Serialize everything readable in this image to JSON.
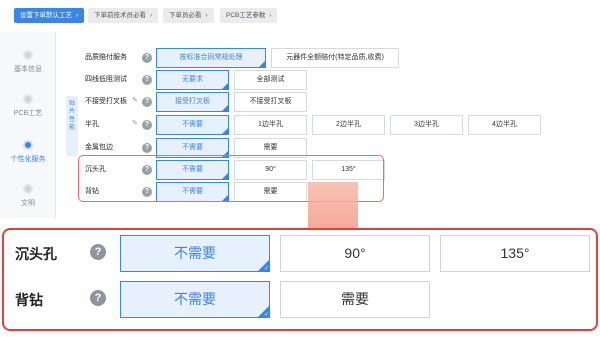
{
  "breadcrumbs": [
    {
      "label": "设置下单默认工艺",
      "active": true
    },
    {
      "label": "下单前技术员必看",
      "active": false
    },
    {
      "label": "下单员必看",
      "active": false
    },
    {
      "label": "PCB工艺参数",
      "active": false
    }
  ],
  "sidenav": {
    "items": [
      {
        "label": "基本信息",
        "active": false
      },
      {
        "label": "PCB工艺",
        "active": false
      },
      {
        "label": "个性化服务",
        "active": true
      },
      {
        "label": "文明",
        "active": false
      }
    ]
  },
  "vertical_tag": [
    "贴",
    "片",
    "性",
    "能"
  ],
  "form": {
    "rows": [
      {
        "label": "品质赔付服务",
        "has_help": true,
        "editable": false,
        "options": [
          {
            "text": "按标准合同常规处理",
            "selected": true
          },
          {
            "text": "元器件全额赔付(特定品质,收费)",
            "selected": false
          }
        ]
      },
      {
        "label": "四线低阻测试",
        "has_help": true,
        "editable": false,
        "options": [
          {
            "text": "无要求",
            "selected": true
          },
          {
            "text": "全部测试",
            "selected": false
          }
        ]
      },
      {
        "label": "不接受打叉板",
        "has_help": true,
        "editable": true,
        "options": [
          {
            "text": "接受打叉板",
            "selected": true
          },
          {
            "text": "不接受打叉板",
            "selected": false
          }
        ]
      },
      {
        "label": "半孔",
        "has_help": true,
        "editable": true,
        "options": [
          {
            "text": "不需要",
            "selected": true
          },
          {
            "text": "1边半孔",
            "selected": false
          },
          {
            "text": "2边半孔",
            "selected": false
          },
          {
            "text": "3边半孔",
            "selected": false
          },
          {
            "text": "4边半孔",
            "selected": false
          }
        ]
      },
      {
        "label": "金属包边",
        "has_help": true,
        "editable": false,
        "options": [
          {
            "text": "不需要",
            "selected": true
          },
          {
            "text": "需要",
            "selected": false
          }
        ]
      },
      {
        "label": "沉头孔",
        "has_help": true,
        "editable": false,
        "options": [
          {
            "text": "不需要",
            "selected": true
          },
          {
            "text": "90°",
            "selected": false
          },
          {
            "text": "135°",
            "selected": false
          }
        ]
      },
      {
        "label": "背钻",
        "has_help": true,
        "editable": false,
        "options": [
          {
            "text": "不需要",
            "selected": true
          },
          {
            "text": "需要",
            "selected": false
          }
        ]
      }
    ]
  },
  "zoom": {
    "rows": [
      {
        "label": "沉头孔",
        "options": [
          {
            "text": "不需要",
            "selected": true
          },
          {
            "text": "90°",
            "selected": false
          },
          {
            "text": "135°",
            "selected": false
          }
        ]
      },
      {
        "label": "背钻",
        "options": [
          {
            "text": "不需要",
            "selected": true
          },
          {
            "text": "需要",
            "selected": false
          }
        ]
      }
    ]
  },
  "icons": {
    "help": "question-circle-icon",
    "edit": "pencil-icon",
    "arrow": "down-arrow-icon"
  },
  "colors": {
    "accent": "#3a86e6",
    "highlight_border": "#e3403a",
    "arrow": "#f28b78"
  }
}
